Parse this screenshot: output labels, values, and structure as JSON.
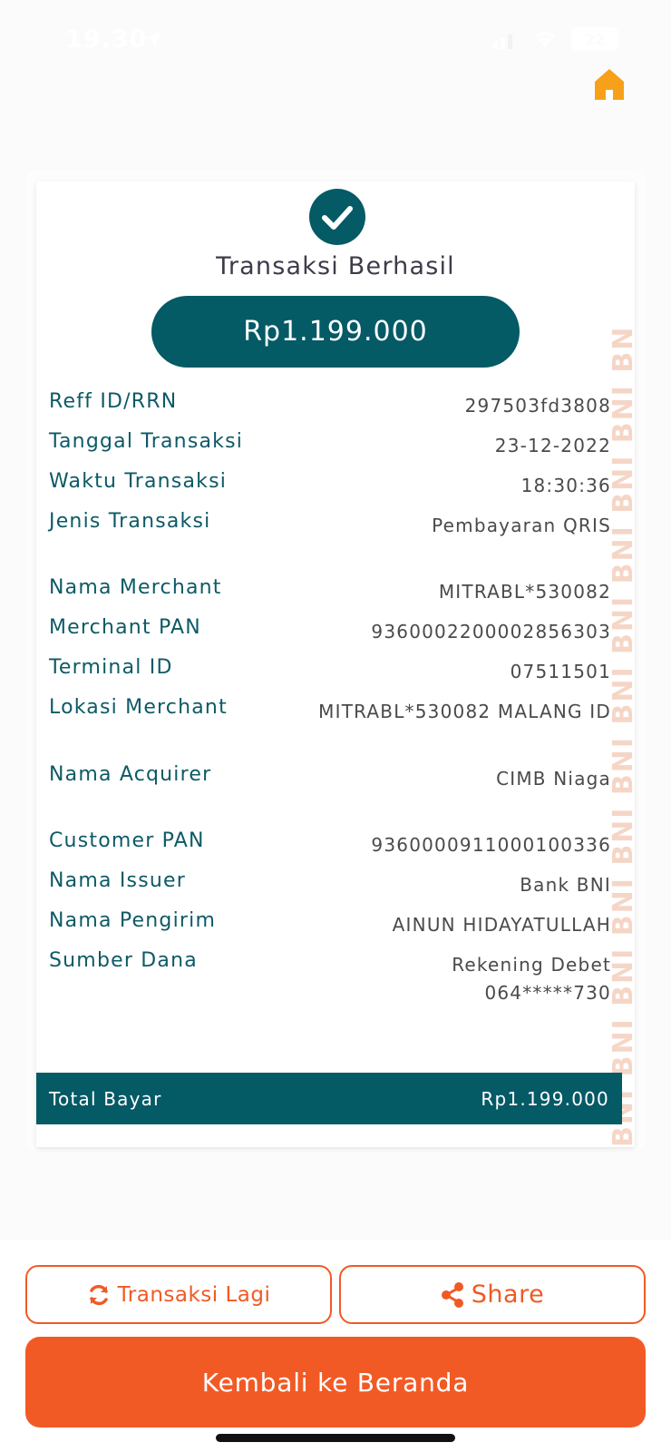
{
  "status_bar": {
    "time": "19.30",
    "battery": "22"
  },
  "colors": {
    "teal": "#045a65",
    "orange": "#f25a25"
  },
  "icons": {
    "home": "home-icon",
    "check": "check-circle-icon",
    "refresh": "refresh-icon",
    "share": "share-icon"
  },
  "receipt": {
    "title": "Transaksi Berhasil",
    "amount": "Rp1.199.000",
    "watermark": "BNI BNI BNI BNI BNI BNI BNI BNI BNI BNI BNI BN",
    "rows": [
      {
        "label": "Reff ID/RRN",
        "value": "297503fd3808"
      },
      {
        "label": "Tanggal Transaksi",
        "value": "23-12-2022"
      },
      {
        "label": "Waktu Transaksi",
        "value": "18:30:36"
      },
      {
        "label": "Jenis Transaksi",
        "value": "Pembayaran QRIS"
      },
      {
        "label": "Nama Merchant",
        "value": "MITRABL*530082"
      },
      {
        "label": "Merchant PAN",
        "value": "9360002200002856303"
      },
      {
        "label": "Terminal ID",
        "value": "07511501"
      },
      {
        "label": "Lokasi Merchant",
        "value": "MITRABL*530082 MALANG ID"
      },
      {
        "label": "Nama Acquirer",
        "value": "CIMB Niaga"
      },
      {
        "label": "Customer PAN",
        "value": "9360000911000100336"
      },
      {
        "label": "Nama Issuer",
        "value": "Bank BNI"
      },
      {
        "label": "Nama Pengirim",
        "value": "AINUN HIDAYATULLAH"
      },
      {
        "label": "Sumber Dana",
        "value": "Rekening Debet 064*****730"
      }
    ],
    "total_label": "Total Bayar",
    "total_value": "Rp1.199.000"
  },
  "actions": {
    "retry_label": "Transaksi Lagi",
    "share_label": "Share",
    "home_label": "Kembali ke Beranda"
  }
}
